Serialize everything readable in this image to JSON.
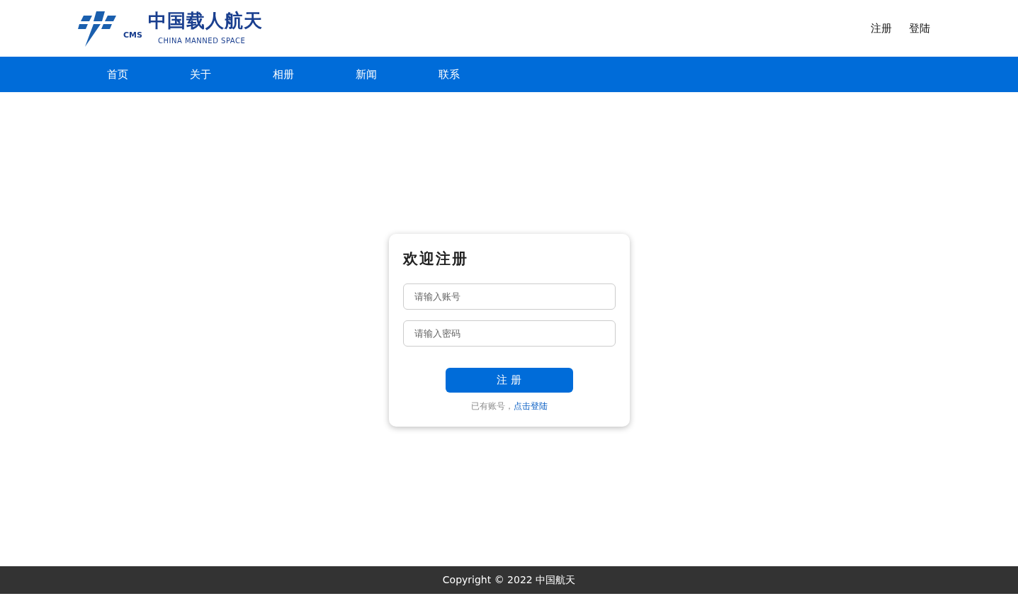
{
  "header": {
    "logo": {
      "title": "中国载人航天",
      "subtitle": "CHINA MANNED SPACE",
      "mark_text": "CMS"
    },
    "links": [
      {
        "label": "注册"
      },
      {
        "label": "登陆"
      }
    ]
  },
  "nav": {
    "items": [
      {
        "label": "首页"
      },
      {
        "label": "关于"
      },
      {
        "label": "相册"
      },
      {
        "label": "新闻"
      },
      {
        "label": "联系"
      }
    ]
  },
  "form": {
    "title": "欢迎注册",
    "fields": [
      {
        "placeholder": "请输入账号"
      },
      {
        "placeholder": "请输入密码"
      }
    ],
    "submit": "注 册",
    "prompt": "已有账号，",
    "prompt_link": "点击登陆"
  },
  "footer": {
    "text": "Copyright © 2022 中国航天"
  }
}
